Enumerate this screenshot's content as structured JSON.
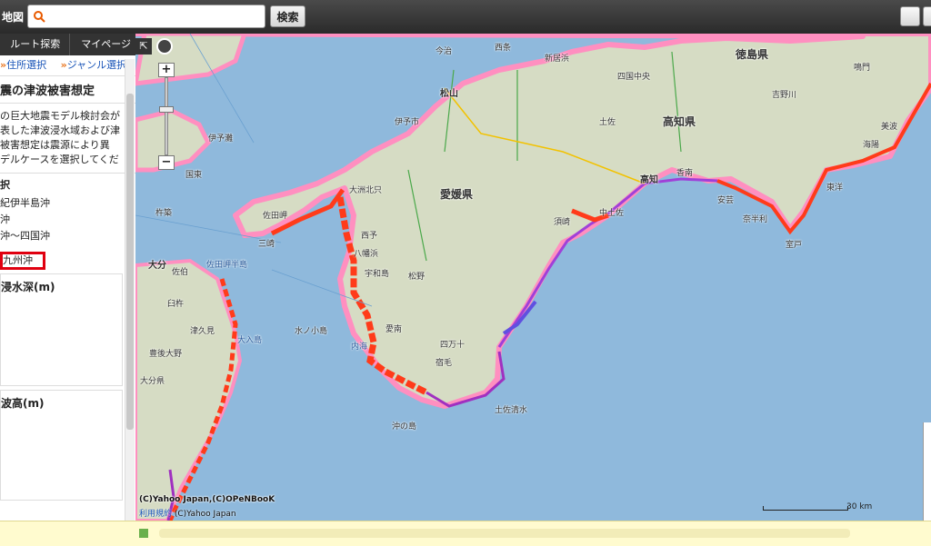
{
  "header": {
    "app_title": "地図",
    "search_placeholder": "",
    "search_button": "検索"
  },
  "sidebar": {
    "tabs": [
      {
        "label": "ルート探索"
      },
      {
        "label": "マイページ"
      }
    ],
    "links": [
      {
        "label": "住所選択"
      },
      {
        "label": "ジャンル選択"
      }
    ],
    "title": "震の津波被害想定",
    "description": [
      "の巨大地震モデル検討会が",
      "表した津波浸水域および津",
      "被害想定は震源により異",
      "デルケースを選択してくだ"
    ],
    "selection_heading": "択",
    "options": [
      {
        "label": "紀伊半島沖"
      },
      {
        "label": "沖"
      },
      {
        "label": "沖〜四国沖"
      }
    ],
    "selected_option": "九州沖",
    "section_depth": "浸水深(m)",
    "section_height": "波高(m)"
  },
  "map": {
    "prefectures": [
      "愛媛県",
      "高知県",
      "徳島県"
    ],
    "cities": [
      "松山",
      "高知",
      "大分"
    ],
    "places": [
      "伊予灘",
      "伊予市",
      "大洲北只",
      "八幡浜",
      "佐田岬",
      "三崎",
      "西予",
      "宇和島",
      "松野",
      "愛南",
      "宿毛",
      "土佐清水",
      "四万十",
      "須崎",
      "中土佐",
      "土佐",
      "香南",
      "安芸",
      "奈半利",
      "室戸",
      "東洋",
      "佐伯",
      "臼杵",
      "豊後大野",
      "津久見",
      "国東",
      "杵築",
      "大分県",
      "水ノ小島",
      "沖の島",
      "四国中央",
      "新居浜",
      "西条",
      "今治",
      "吉野川",
      "鳴門",
      "美波",
      "海陽"
    ],
    "water_labels": [
      "佐田岬半島",
      "大入島",
      "内海"
    ],
    "copyright": "(C)Yahoo Japan,(C)OPeNBooK",
    "terms_link": "利用規約",
    "terms_suffix": " (C)Yahoo Japan",
    "scale_label": "30 km",
    "colors": {
      "sea": "#8fb9dc",
      "land": "#d6dcc4",
      "tsunami_red": "#ff3b1a",
      "tsunami_purple": "#8a2be2",
      "flood_pink": "#ff8fc0"
    }
  }
}
